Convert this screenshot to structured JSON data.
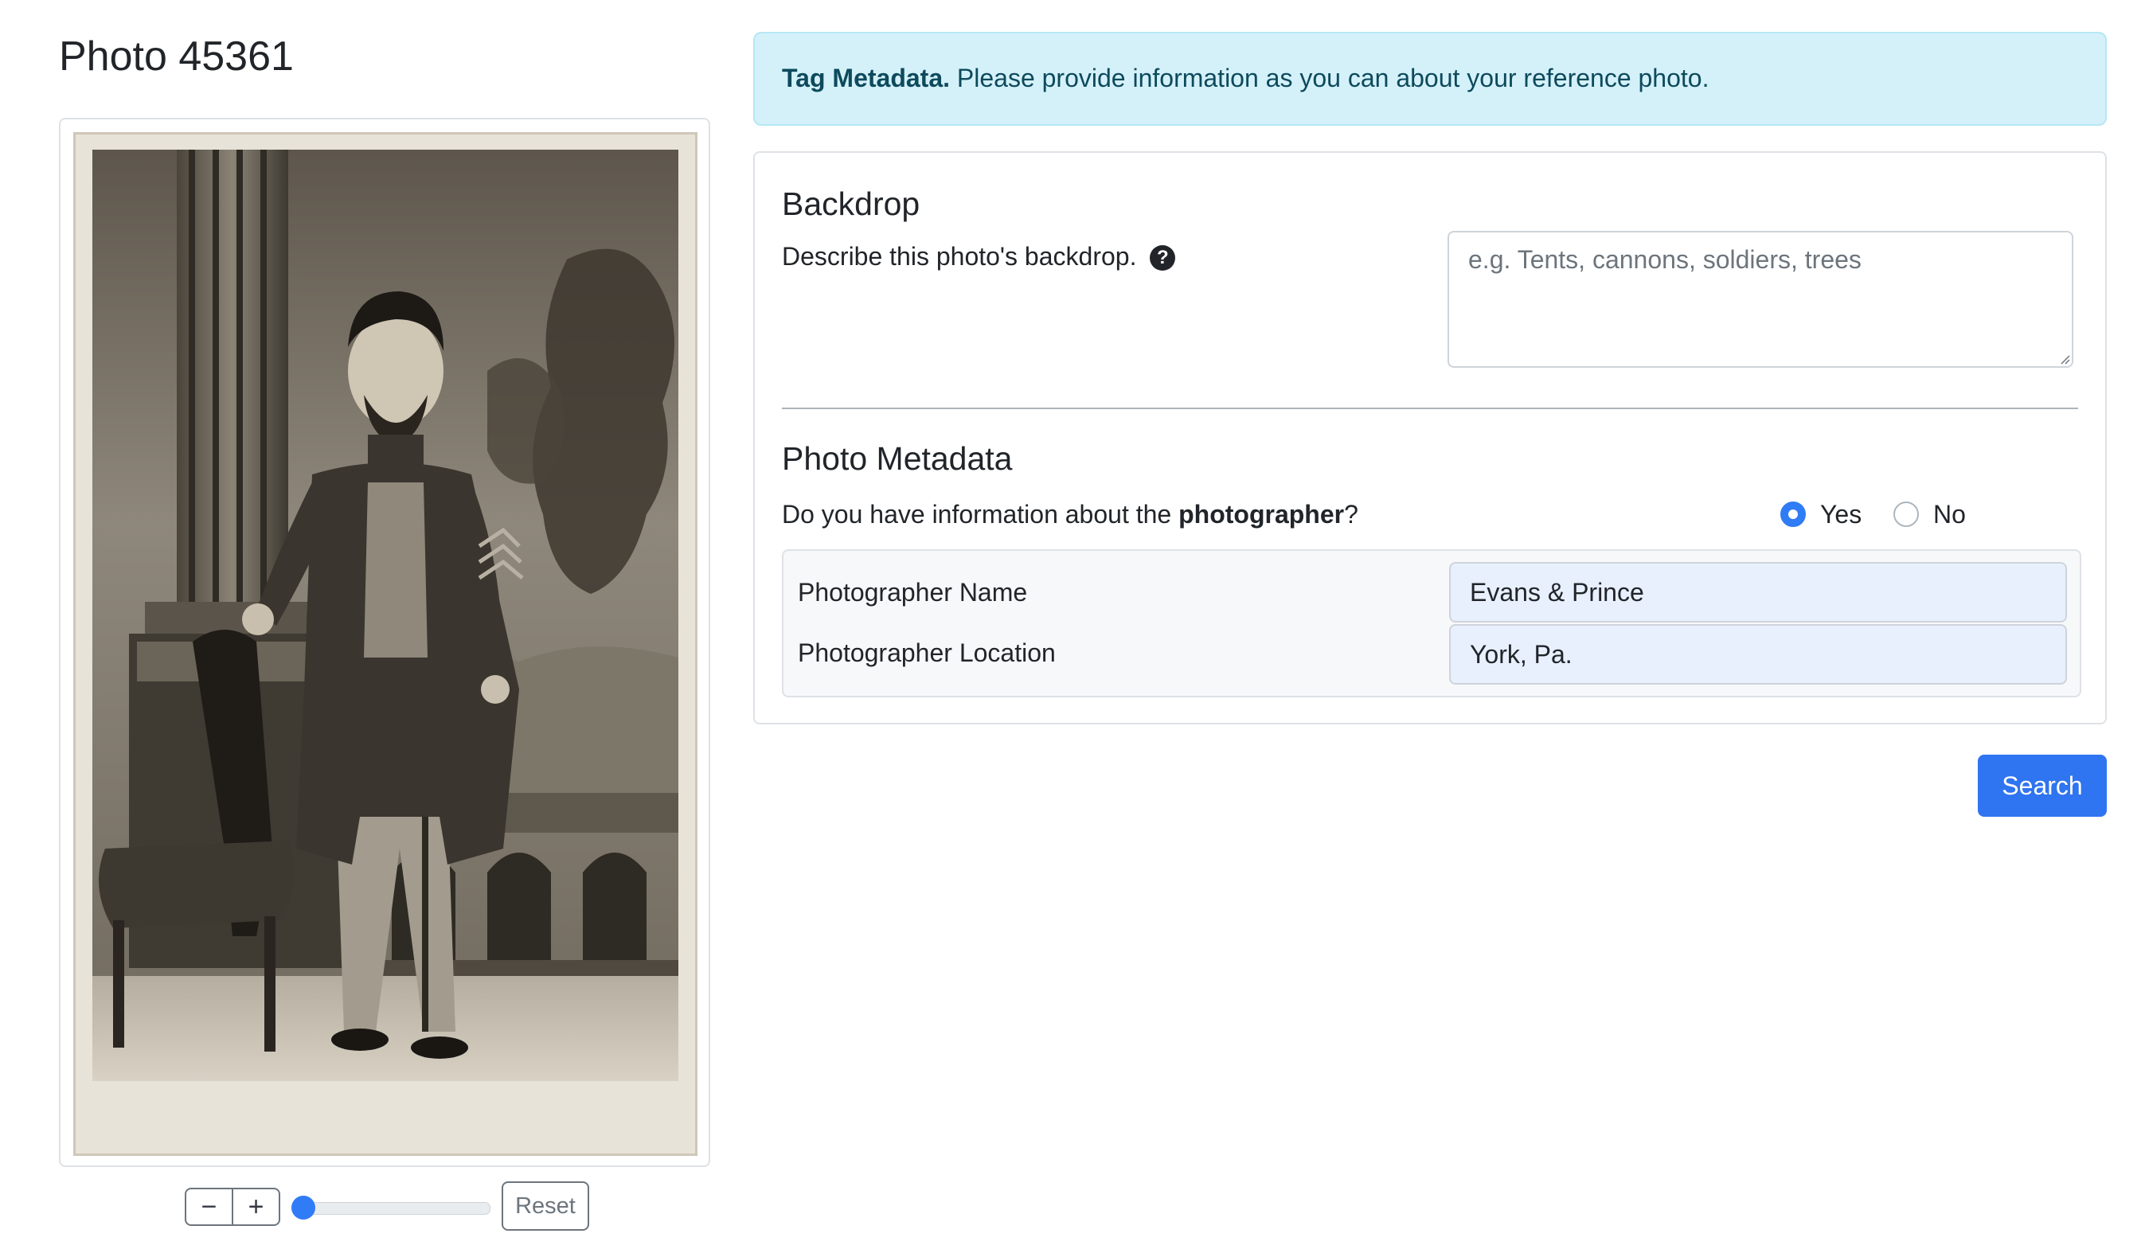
{
  "page": {
    "title": "Photo 45361"
  },
  "image_viewer": {
    "zoom_out_label": "−",
    "zoom_in_label": "+",
    "zoom_level": 0,
    "reset_label": "Reset"
  },
  "alert": {
    "title": "Tag Metadata.",
    "message": "Please provide information as you can about your reference photo."
  },
  "backdrop": {
    "title": "Backdrop",
    "question": "Describe this photo's backdrop.",
    "help_icon": "question-circle-icon",
    "placeholder": "e.g. Tents, cannons, soldiers, trees",
    "value": ""
  },
  "photo_metadata": {
    "title": "Photo Metadata",
    "question_prefix": "Do you have information about the ",
    "question_bold": "photographer",
    "question_suffix": "?",
    "options": [
      {
        "label": "Yes",
        "checked": true
      },
      {
        "label": "No",
        "checked": false
      }
    ],
    "fields": [
      {
        "label": "Photographer Name",
        "value": "Evans & Prince"
      },
      {
        "label": "Photographer Location",
        "value": "York, Pa."
      }
    ]
  },
  "actions": {
    "search_label": "Search"
  },
  "colors": {
    "primary": "#2f74f0",
    "alert_bg": "#d4f1fa",
    "alert_text": "#0d4a5c",
    "autofill_bg": "#e8f0fe"
  }
}
